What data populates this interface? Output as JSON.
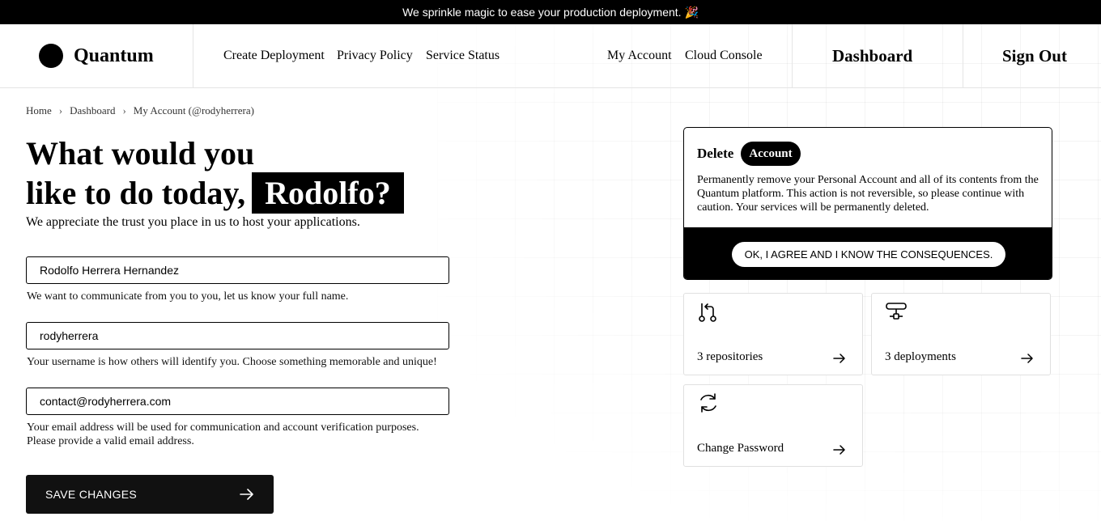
{
  "announcement": {
    "text": "We sprinkle magic to ease your production deployment. 🎉"
  },
  "brand": {
    "name": "Quantum"
  },
  "nav": {
    "left": [
      "Create Deployment",
      "Privacy Policy",
      "Service Status"
    ],
    "right": [
      "My Account",
      "Cloud Console"
    ],
    "dashboard": "Dashboard",
    "sign_out": "Sign Out"
  },
  "breadcrumb": [
    "Home",
    "Dashboard",
    "My Account (@rodyherrera)"
  ],
  "headline": {
    "line1": "What would you",
    "line2": "like to do today,",
    "name": "Rodolfo?",
    "subtitle": "We appreciate the trust you place in us to host your applications."
  },
  "form": {
    "full_name": {
      "value": "Rodolfo Herrera Hernandez",
      "help": "We want to communicate from you to you, let us know your full name."
    },
    "username": {
      "value": "rodyherrera",
      "help": "Your username is how others will identify you. Choose something memorable and unique!"
    },
    "email": {
      "value": "contact@rodyherrera.com",
      "help_line1": "Your email address will be used for communication and account verification purposes.",
      "help_line2": "Please provide a valid email address."
    },
    "save_label": "SAVE CHANGES"
  },
  "delete_card": {
    "title": "Delete",
    "badge": "Account",
    "description": "Permanently remove your Personal Account and all of its contents from the Quantum platform. This action is not reversible, so please continue with caution. Your services will be permanently deleted.",
    "button": "OK, I AGREE AND I KNOW THE CONSEQUENCES."
  },
  "tiles": [
    {
      "label": "3 repositories",
      "icon": "git-pull-request-icon"
    },
    {
      "label": "3 deployments",
      "icon": "server-icon"
    },
    {
      "label": "Change Password",
      "icon": "refresh-icon"
    }
  ],
  "colors": {
    "primary": "#000000",
    "background": "#ffffff",
    "border": "#e5e5e5"
  }
}
